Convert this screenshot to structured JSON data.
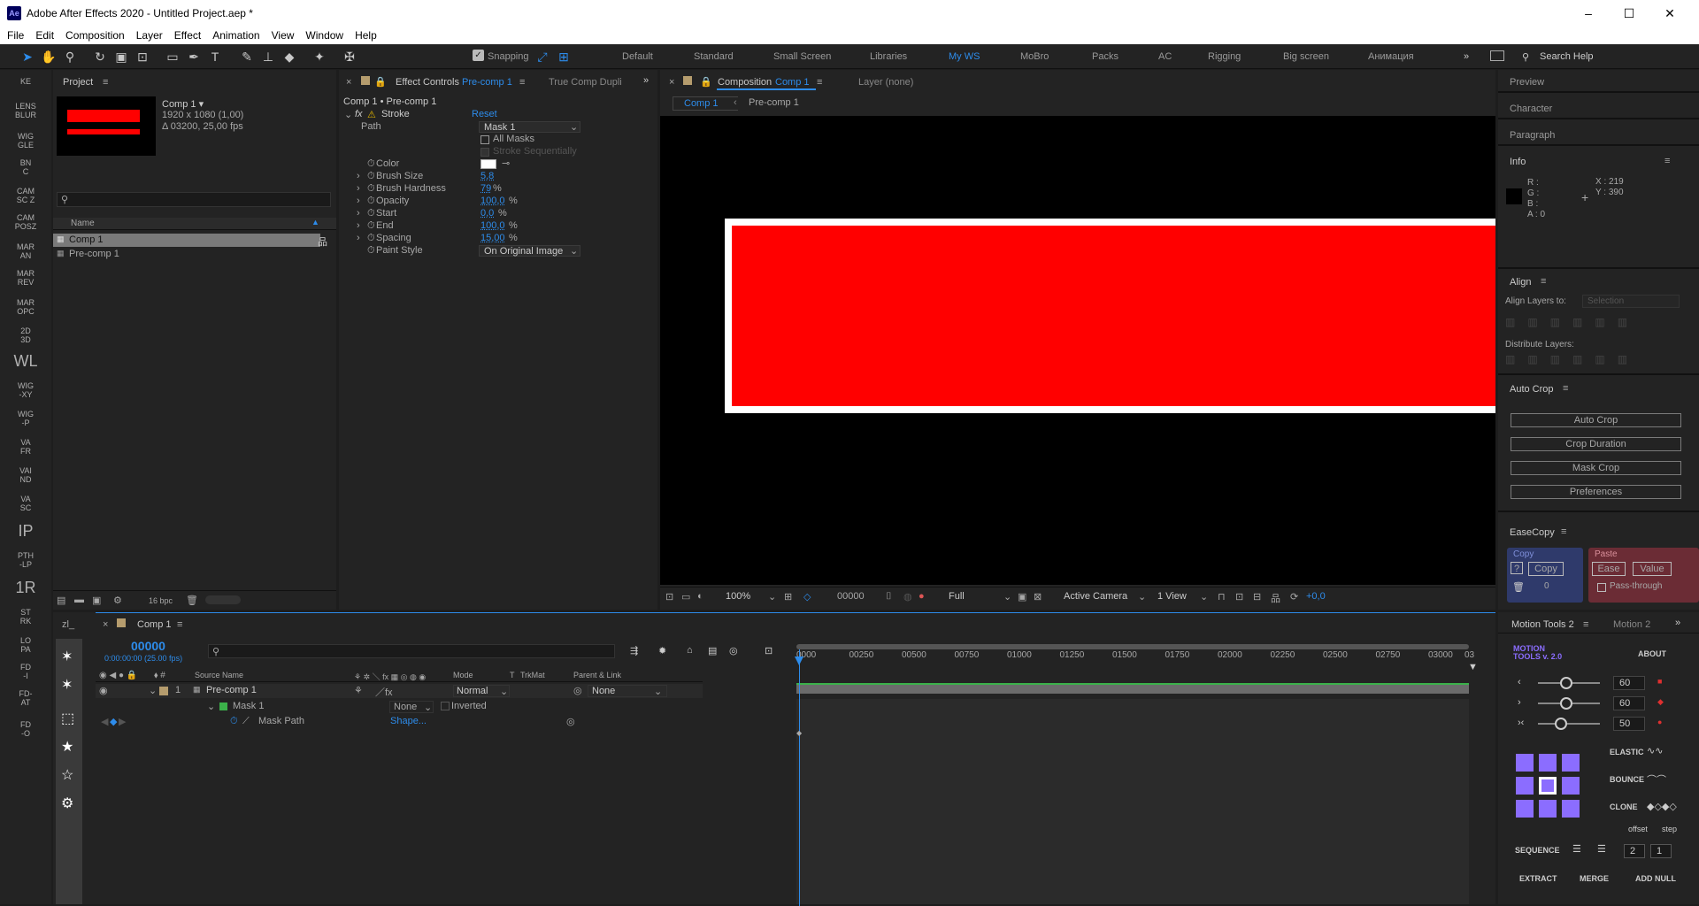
{
  "window": {
    "title": "Adobe After Effects 2020 - Untitled Project.aep *",
    "app_icon": "Ae",
    "controls": [
      "–",
      "☐",
      "✕"
    ]
  },
  "menu": [
    "File",
    "Edit",
    "Composition",
    "Layer",
    "Effect",
    "Animation",
    "View",
    "Window",
    "Help"
  ],
  "toolbar": {
    "snapping_label": "Snapping",
    "workspaces": [
      "Default",
      "Standard",
      "Small Screen",
      "Libraries",
      "My WS",
      "MoBro",
      "Packs",
      "AC",
      "Rigging",
      "Big screen",
      "Анимация"
    ],
    "active_workspace": "My WS",
    "search_placeholder": "Search Help"
  },
  "left_scripts": [
    "KE",
    "LENS\nBLUR",
    "WIG\nGLE",
    "BN\nC",
    "CAM\nSC Z",
    "CAM\nPOSZ",
    "MAR\nAN",
    "MAR\nREV",
    "MAR\nOPC",
    "2D\n3D",
    "WL",
    "WIG\n-XY",
    "WIG\n-P",
    "VA\nFR",
    "VAI\nND",
    "VA\nSC",
    "IP",
    "PTH\n-LP",
    "1R",
    "ST\nRK",
    "LO\nPA",
    "FD\n-I",
    "FD-\nAT",
    "FD\n-O"
  ],
  "project": {
    "tab": "Project",
    "comp_name": "Comp 1 ▾",
    "comp_size": "1920 x 1080 (1,00)",
    "comp_duration": "Δ 03200, 25,00 fps",
    "col_name": "Name",
    "items": [
      "Comp 1",
      "Pre-comp 1"
    ],
    "bpc": "16 bpc"
  },
  "effect_controls": {
    "tab_label": "Effect Controls",
    "tab_target": "Pre-comp 1",
    "tab2": "True Comp Dupli",
    "header": "Comp 1 • Pre-comp 1",
    "effect_name": "Stroke",
    "reset": "Reset",
    "rows": [
      {
        "label": "Path",
        "value": "Mask 1"
      },
      {
        "label": "",
        "value": "All Masks"
      },
      {
        "label": "",
        "value": "Stroke Sequentially"
      },
      {
        "label": "Color",
        "value": ""
      },
      {
        "label": "Brush Size",
        "value": "5,8"
      },
      {
        "label": "Brush Hardness",
        "value": "79",
        "unit": "%"
      },
      {
        "label": "Opacity",
        "value": "100,0",
        "unit": "%"
      },
      {
        "label": "Start",
        "value": "0,0",
        "unit": "%"
      },
      {
        "label": "End",
        "value": "100,0",
        "unit": "%"
      },
      {
        "label": "Spacing",
        "value": "15,00",
        "unit": "%"
      },
      {
        "label": "Paint Style",
        "value": "On Original Image"
      }
    ]
  },
  "composition": {
    "tab_label": "Composition",
    "tab_target": "Comp 1",
    "layer_tab": "Layer (none)",
    "breadcrumbs": [
      "Comp 1",
      "Pre-comp 1"
    ],
    "zoom": "100%",
    "timecode": "00000",
    "resolution": "Full",
    "camera": "Active Camera",
    "view": "1 View",
    "exposure": "+0,0"
  },
  "right_panels": {
    "preview": "Preview",
    "character": "Character",
    "paragraph": "Paragraph",
    "info": "Info",
    "info_rgba": [
      "R :",
      "G :",
      "B :",
      "A : 0"
    ],
    "info_x": "X : 219",
    "info_y": "Y : 390",
    "align": "Align",
    "align_layers_to": "Align Layers to:",
    "align_select": "Selection",
    "distribute": "Distribute Layers:",
    "auto_crop": "Auto Crop",
    "auto_crop_buttons": [
      "Auto Crop",
      "Crop Duration",
      "Mask Crop",
      "Preferences"
    ],
    "easecopy": "EaseCopy",
    "ec_copy_title": "Copy",
    "ec_copy_btn": "Copy",
    "ec_count": "0",
    "ec_paste_title": "Paste",
    "ec_ease": "Ease",
    "ec_value": "Value",
    "ec_passthrough": "Pass-through"
  },
  "timeline": {
    "tab": "Comp 1",
    "left_tab": "zl_",
    "timecode": "00000",
    "timecode_sub": "0:00:00:00 (25.00 fps)",
    "col_source": "Source Name",
    "col_mode": "Mode",
    "col_t": "T",
    "col_trkmat": "TrkMat",
    "col_parent": "Parent & Link",
    "layer_num": "1",
    "layer_name": "Pre-comp 1",
    "layer_mode": "Normal",
    "layer_parent": "None",
    "mask_name": "Mask 1",
    "mask_mode": "None",
    "mask_inverted": "Inverted",
    "mask_path": "Mask Path",
    "mask_shape": "Shape...",
    "ruler": [
      "0000",
      "00250",
      "00500",
      "00750",
      "01000",
      "01250",
      "01500",
      "01750",
      "02000",
      "02250",
      "02500",
      "02750",
      "03000",
      "03"
    ]
  },
  "motion_tools": {
    "tab1": "Motion Tools 2",
    "tab2": "Motion 2",
    "logo_line1": "MOTION",
    "logo_line2": "TOOLS v. 2.0",
    "about": "ABOUT",
    "values": [
      "60",
      "60",
      "50"
    ],
    "elastic": "ELASTIC",
    "bounce": "BOUNCE",
    "clone": "CLONE",
    "offset": "offset",
    "step": "step",
    "sequence": "SEQUENCE",
    "seq_values": [
      "2",
      "1"
    ],
    "extract": "EXTRACT",
    "merge": "MERGE",
    "add_null": "ADD NULL"
  },
  "colors": {
    "accent": "#2d8ceb",
    "comp_red": "#ff0000",
    "panel_bg": "#232323",
    "purple": "#8b6dff"
  }
}
